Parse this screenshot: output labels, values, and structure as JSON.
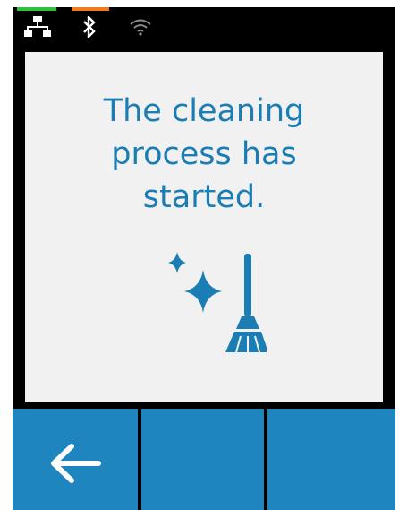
{
  "status_bar": {
    "indicator_colors": {
      "left": "#2ec13c",
      "right": "#f07a1e"
    },
    "icons": [
      "network-icon",
      "bluetooth-icon",
      "wifi-icon"
    ]
  },
  "message": {
    "lines": [
      "The cleaning",
      "process has",
      "started."
    ],
    "color": "#1a7eb4"
  },
  "illustration": {
    "icon": "cleaning-broom-sparkle-icon",
    "color": "#1a7eb4"
  },
  "bottom_bar": {
    "button_color": "#1f85bf",
    "buttons": [
      {
        "icon": "arrow-left-icon"
      },
      {
        "icon": ""
      },
      {
        "icon": ""
      }
    ]
  }
}
